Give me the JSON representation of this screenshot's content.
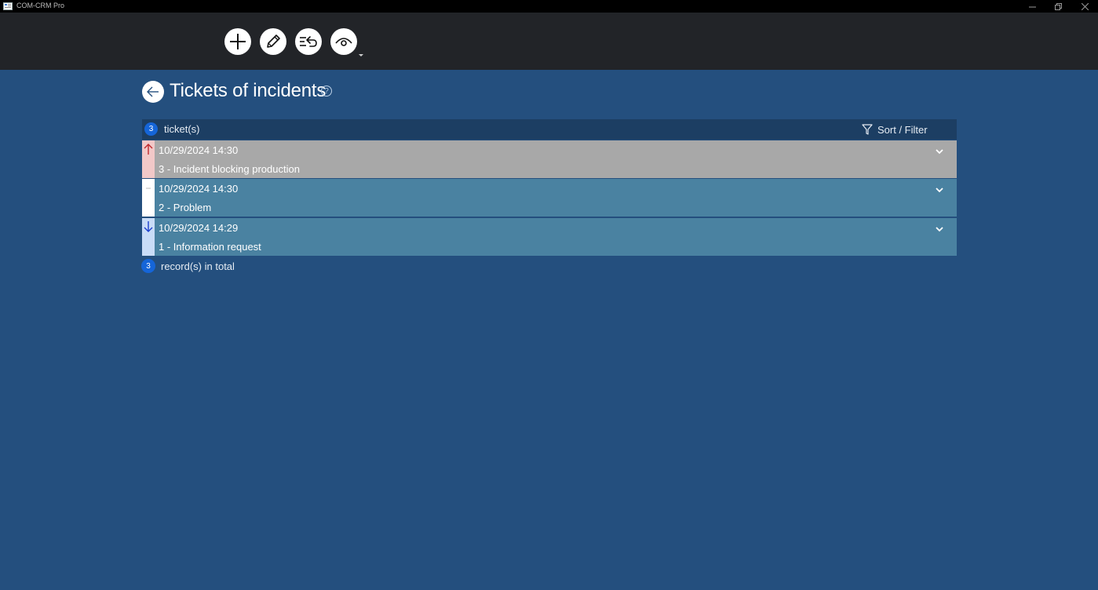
{
  "window": {
    "title": "COM-CRM Pro"
  },
  "toolbar": {
    "buttons": [
      {
        "name": "add",
        "icon": "plus-icon"
      },
      {
        "name": "edit",
        "icon": "pencil-icon"
      },
      {
        "name": "reply",
        "icon": "mail-reply-icon"
      },
      {
        "name": "view",
        "icon": "eye-icon",
        "has_dropdown": true
      }
    ]
  },
  "page": {
    "title": "Tickets of incidents"
  },
  "list": {
    "count": "3",
    "count_label": "ticket(s)",
    "sort_filter_label": "Sort / Filter",
    "tickets": [
      {
        "date": "10/29/2024 14:30",
        "title": "3 - Incident blocking production",
        "priority": "high",
        "row_color": "#a8a8a8",
        "priority_color": "#f2c8c8",
        "icon": "arrow-up-icon"
      },
      {
        "date": "10/29/2024 14:30",
        "title": "2 - Problem",
        "priority": "normal",
        "row_color": "#4a82a1",
        "priority_color": "#ffffff",
        "icon": "dash-icon"
      },
      {
        "date": "10/29/2024 14:29",
        "title": "1 - Information request",
        "priority": "low",
        "row_color": "#4a82a1",
        "priority_color": "#c9dcf7",
        "icon": "arrow-down-icon"
      }
    ]
  },
  "footer": {
    "total": "3",
    "total_label": "record(s) in total"
  },
  "colors": {
    "background": "#244f7e",
    "toolbar": "#222428",
    "header": "#1c3e63",
    "badge": "#1565d8"
  }
}
